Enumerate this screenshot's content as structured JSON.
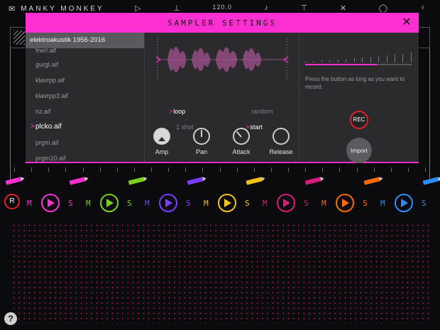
{
  "app": {
    "title": "MANKY MONKEY",
    "tempo": "120.0",
    "icons": [
      "play-icon",
      "metronome-icon",
      "note-icon",
      "crossfader-icon",
      "search-icon",
      "settings-icon",
      "more-icon"
    ]
  },
  "dialog": {
    "title": "SAMPLER SETTINGS",
    "folder": "elektroakustik 1956-2016",
    "files": [
      {
        "name": "frwrl.aif",
        "selected": false
      },
      {
        "name": "gurgl.aif",
        "selected": false
      },
      {
        "name": "klavrpp.aif",
        "selected": false
      },
      {
        "name": "klavrpp3.aif",
        "selected": false
      },
      {
        "name": "nz.aif",
        "selected": false
      },
      {
        "name": "plcko.aif",
        "selected": true
      },
      {
        "name": "prgm.aif",
        "selected": false
      },
      {
        "name": "prgm10.aif",
        "selected": false
      }
    ],
    "options": {
      "loop": "loop",
      "random": "random",
      "one_shot": "1 shot",
      "start": "start"
    },
    "knobs": {
      "amp": "Amp",
      "pan": "Pan",
      "attack": "Attack",
      "release": "Release"
    },
    "record": {
      "hint": "Press the button as long as you want to record.",
      "rec_label": "REC",
      "import_label": "Import",
      "level": 0.67
    }
  },
  "channels": {
    "rec_label": "R",
    "mute_label": "M",
    "solo_label": "S",
    "colors": [
      "#ff2fd1",
      "#7ccf1a",
      "#7a3cff",
      "#f2c418",
      "#d61a7a",
      "#ff6a00",
      "#2d8cff"
    ]
  },
  "colors": {
    "accent": "#ff2fd1",
    "record": "#e0202a"
  }
}
